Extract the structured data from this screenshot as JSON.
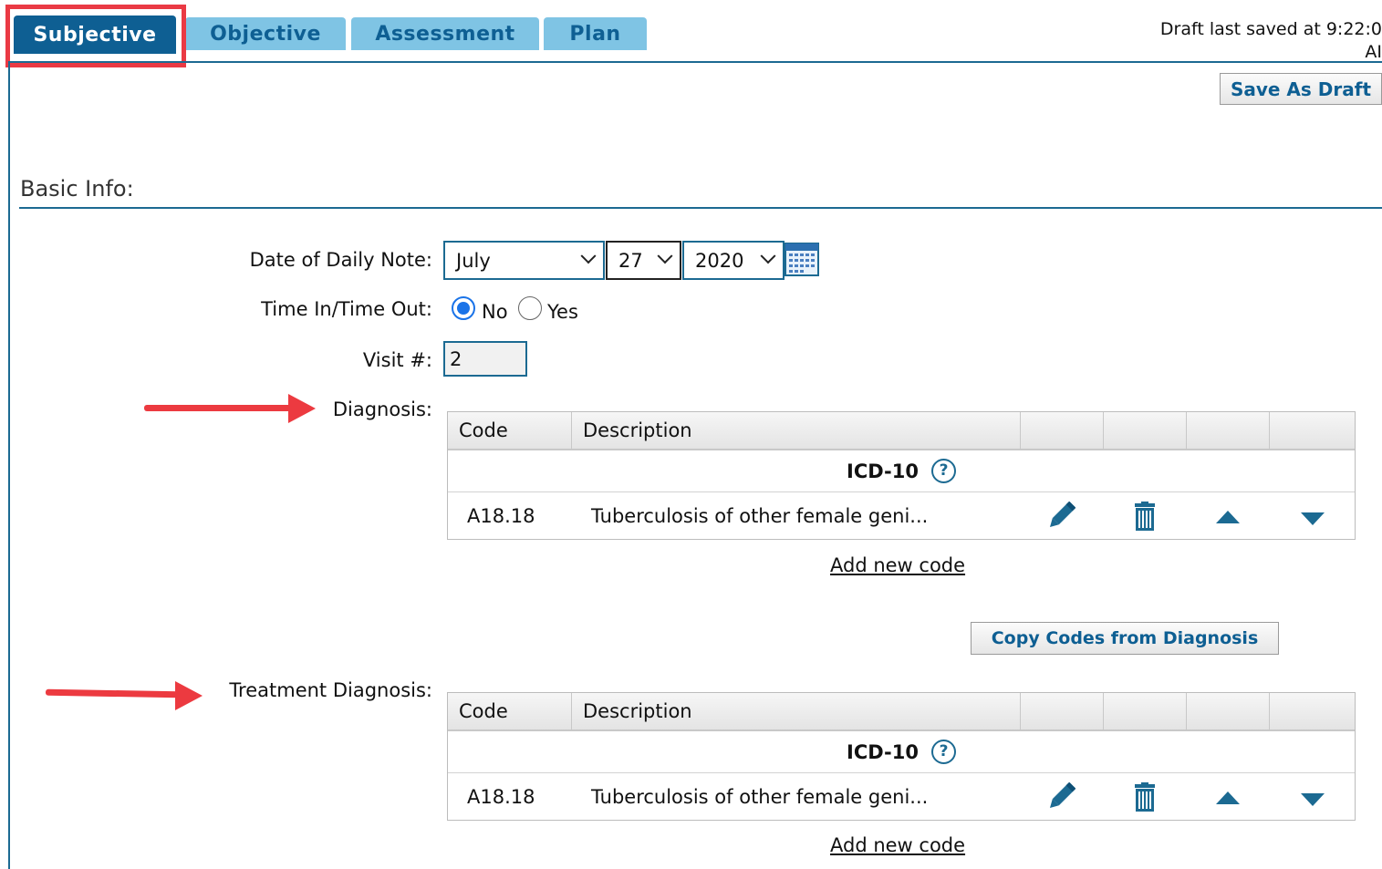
{
  "tabs": [
    {
      "label": "Subjective",
      "active": true
    },
    {
      "label": "Objective",
      "active": false
    },
    {
      "label": "Assessment",
      "active": false
    },
    {
      "label": "Plan",
      "active": false
    }
  ],
  "draft": {
    "line1": "Draft last saved at 9:22:0",
    "line2": "AI"
  },
  "save_draft_label": "Save As Draft",
  "section_title": "Basic Info:",
  "form": {
    "date_label": "Date of Daily Note:",
    "month": "July",
    "day": "27",
    "year": "2020",
    "time_label": "Time In/Time Out:",
    "time_options": [
      "No",
      "Yes"
    ],
    "time_selected": "No",
    "visit_label": "Visit #:",
    "visit_value": "2",
    "diagnosis_label": "Diagnosis:",
    "treatment_label": "Treatment Diagnosis:"
  },
  "diagnosis_table": {
    "headers": [
      "Code",
      "Description",
      "",
      "",
      "",
      ""
    ],
    "group": "ICD-10",
    "rows": [
      {
        "code": "A18.18",
        "description": "Tuberculosis of other female geni..."
      }
    ],
    "add_link": "Add new code"
  },
  "copy_button_label": "Copy Codes from Diagnosis",
  "treatment_table": {
    "headers": [
      "Code",
      "Description",
      "",
      "",
      "",
      ""
    ],
    "group": "ICD-10",
    "rows": [
      {
        "code": "A18.18",
        "description": "Tuberculosis of other female geni..."
      }
    ],
    "add_link": "Add new code"
  },
  "icons": [
    "pencil-icon",
    "trash-icon",
    "arrow-up-icon",
    "arrow-down-icon",
    "calendar-icon",
    "help-icon"
  ],
  "colors": {
    "primary": "#0e5f93",
    "tab_inactive": "#7fc4e4",
    "annotation": "#ec3a40"
  }
}
